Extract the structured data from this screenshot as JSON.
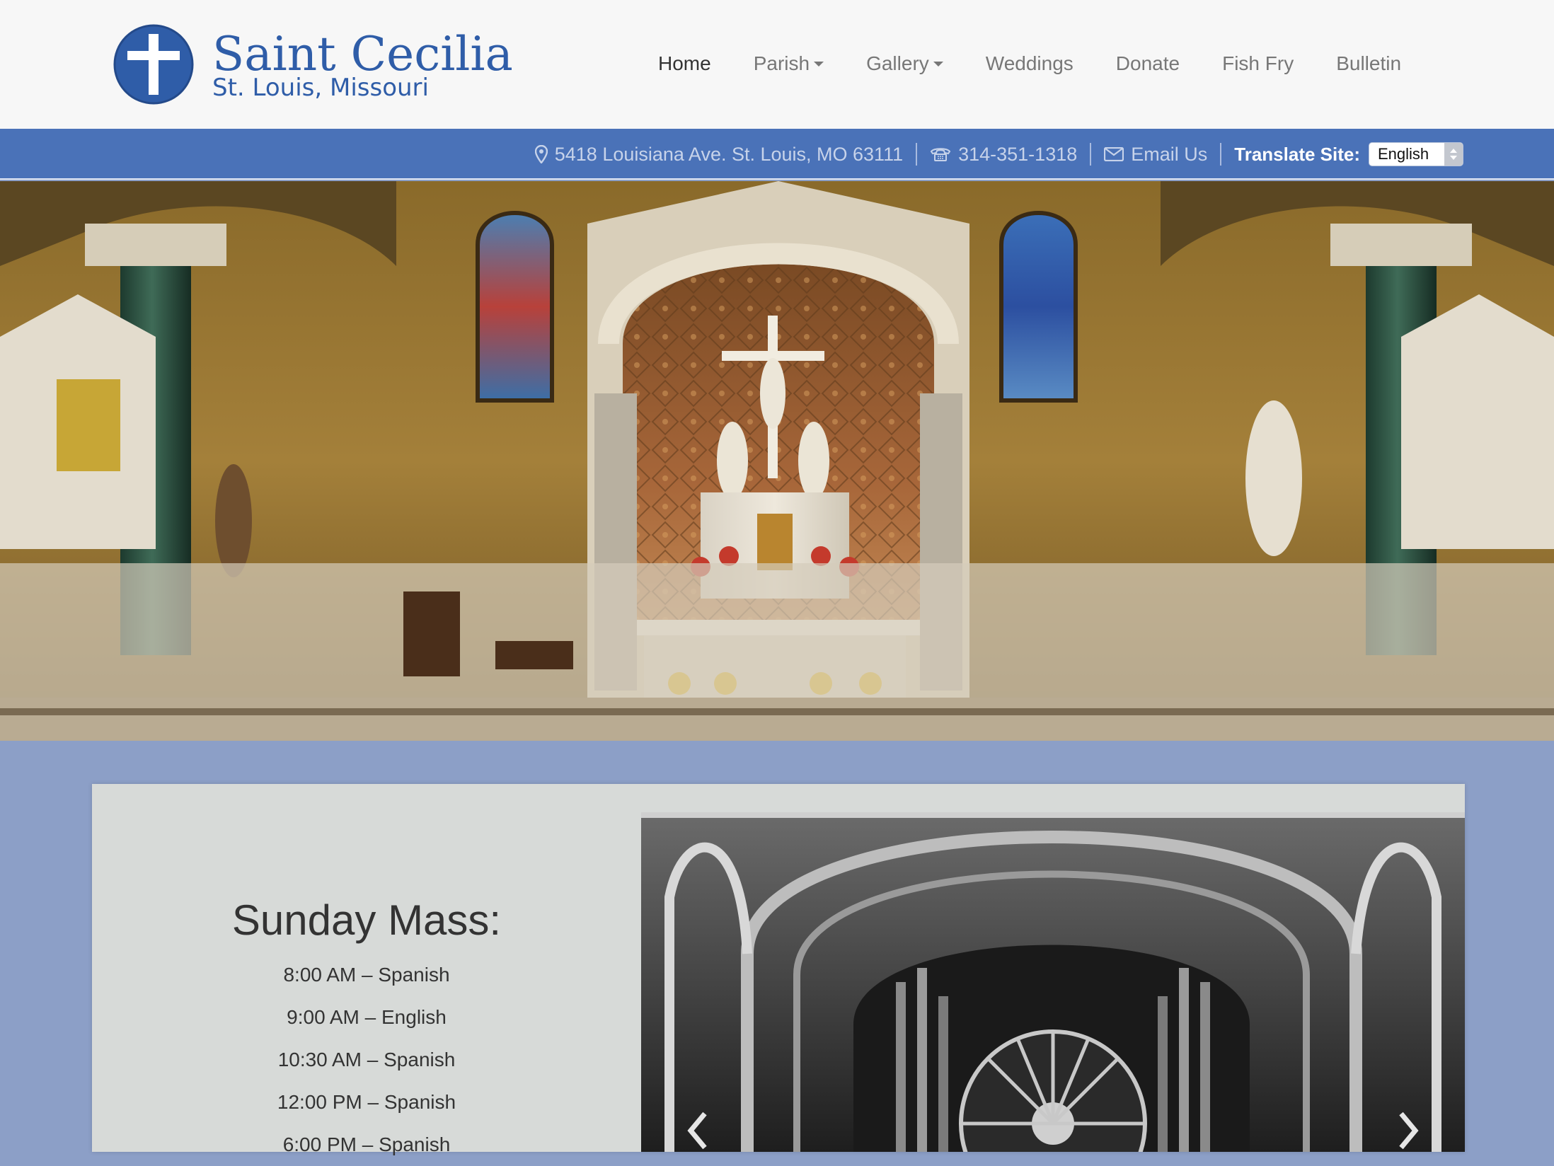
{
  "site": {
    "name": "Saint Cecilia",
    "subtitle": "St. Louis, Missouri"
  },
  "nav": {
    "items": [
      {
        "label": "Home",
        "active": true,
        "dropdown": false
      },
      {
        "label": "Parish",
        "active": false,
        "dropdown": true
      },
      {
        "label": "Gallery",
        "active": false,
        "dropdown": true
      },
      {
        "label": "Weddings",
        "active": false,
        "dropdown": false
      },
      {
        "label": "Donate",
        "active": false,
        "dropdown": false
      },
      {
        "label": "Fish Fry",
        "active": false,
        "dropdown": false
      },
      {
        "label": "Bulletin",
        "active": false,
        "dropdown": false
      }
    ]
  },
  "infobar": {
    "address": "5418 Louisiana Ave. St. Louis, MO 63111",
    "phone": "314-351-1318",
    "email_label": "Email Us",
    "translate_label": "Translate Site:",
    "language_selected": "English"
  },
  "schedule": {
    "title": "Sunday Mass:",
    "items": [
      "8:00 AM – Spanish",
      "9:00 AM – English",
      "10:30 AM – Spanish",
      "12:00 PM – Spanish",
      "6:00 PM – Spanish"
    ]
  },
  "colors": {
    "brand_blue": "#2f5da8",
    "infobar_bg": "#4a72b8",
    "page_bg": "#8c9fc7",
    "card_bg": "#d7dad8"
  },
  "icons": {
    "address": "map-marker-icon",
    "phone": "phone-icon",
    "email": "envelope-icon"
  }
}
